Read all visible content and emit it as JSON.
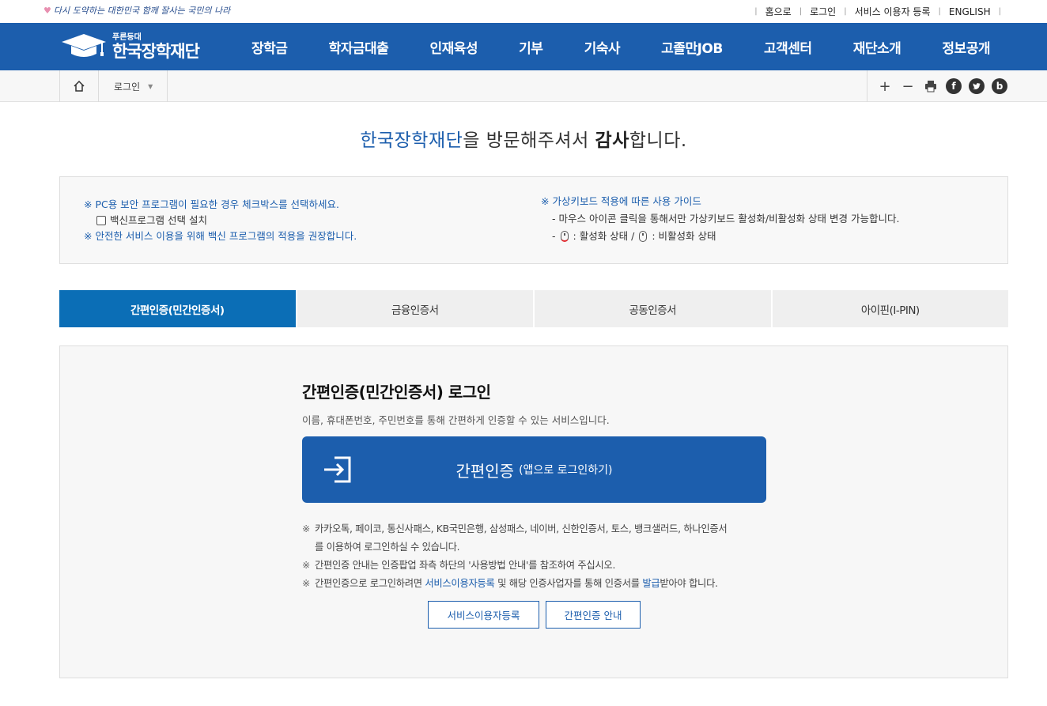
{
  "topbar": {
    "slogan": "다시 도약하는 대한민국 함께 잘사는 국민의 나라",
    "links": [
      "홈으로",
      "로그인",
      "서비스 이용자 등록",
      "ENGLISH"
    ]
  },
  "gnb": {
    "logo_sub": "푸른등대",
    "logo_main": "한국장학재단",
    "menu": [
      "장학금",
      "학자금대출",
      "인재육성",
      "기부",
      "기숙사",
      "고졸만JOB",
      "고객센터",
      "재단소개",
      "정보공개"
    ]
  },
  "breadcrumb": {
    "current": "로그인",
    "tools": [
      "+",
      "−",
      "print-icon",
      "facebook-icon",
      "twitter-icon",
      "blog-icon"
    ]
  },
  "welcome": {
    "part1": "한국장학재단",
    "part2": "을 방문해주셔서 ",
    "part3": "감사",
    "part4": "합니다."
  },
  "info": {
    "left1": "※ PC용 보안 프로그램이 필요한 경우 체크박스를 선택하세요.",
    "checkbox_label": "백신프로그램 선택 설치",
    "left2": "※ 안전한 서비스 이용을 위해 백신 프로그램의 적용을 권장합니다.",
    "right_title": "※ 가상키보드 적용에 따른 사용 가이드",
    "right1": "- 마우스 아이콘 클릭을 통해서만 가상키보드 활성화/비활성화 상태 변경 가능합니다.",
    "right2_a": ": 활성화 상태 /",
    "right2_b": ": 비활성화 상태"
  },
  "tabs": [
    "간편인증(민간인증서)",
    "금융인증서",
    "공동인증서",
    "아이핀(I-PIN)"
  ],
  "panel": {
    "title": "간편인증(민간인증서) 로그인",
    "desc": "이름, 휴대폰번호, 주민번호를 통해 간편하게 인증할 수 있는 서비스입니다.",
    "button_main": "간편인증",
    "button_sub": "(앱으로 로그인하기)",
    "note1a": "카카오톡, 페이코, 통신사패스, KB국민은행, 삼성패스, 네이버, 신한인증서, 토스, 뱅크샐러드, 하나인증서",
    "note1b": "를 이용하여 로그인하실 수 있습니다.",
    "note2": "간편인증 안내는 인증팝업 좌측 하단의 '사용방법 안내'를 참조하여 주십시오.",
    "note3_a": "간편인증으로 로그인하려면 ",
    "note3_link1": "서비스이용자등록",
    "note3_b": " 및 해당 인증사업자를 통해 인증서를 ",
    "note3_link2": "발급",
    "note3_c": "받아야 합니다.",
    "mark": "※",
    "btn1": "서비스이용자등록",
    "btn2": "간편인증 안내"
  }
}
